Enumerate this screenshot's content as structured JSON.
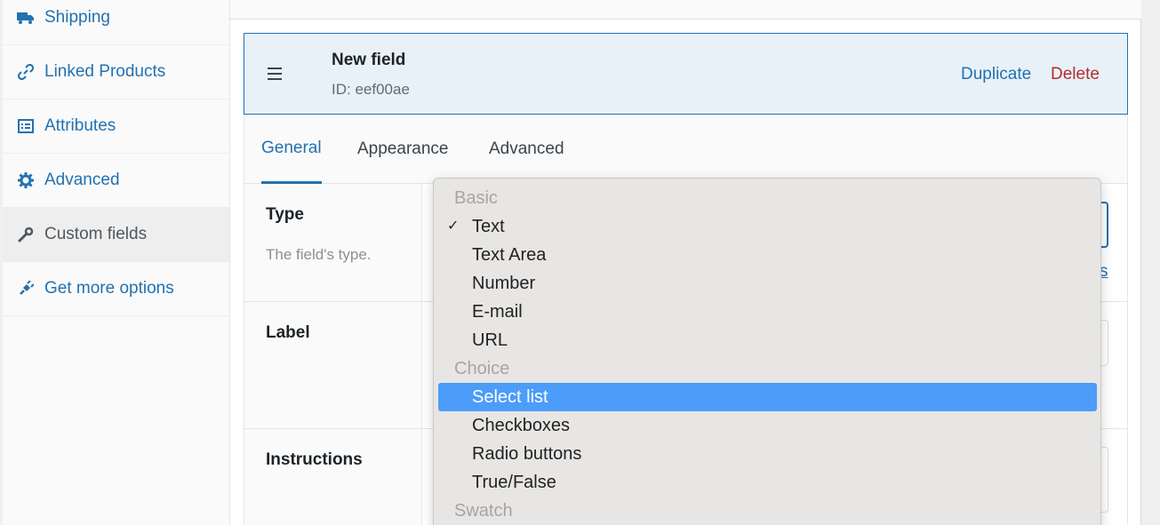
{
  "sidebar": {
    "items": [
      {
        "label": "Shipping",
        "icon": "truck-icon"
      },
      {
        "label": "Linked Products",
        "icon": "link-icon"
      },
      {
        "label": "Attributes",
        "icon": "list-icon"
      },
      {
        "label": "Advanced",
        "icon": "gear-icon"
      },
      {
        "label": "Custom fields",
        "icon": "wrench-icon",
        "active": true
      },
      {
        "label": "Get more options",
        "icon": "plugin-icon"
      }
    ]
  },
  "field": {
    "title": "New field",
    "id_text": "ID: eef00ae",
    "duplicate_label": "Duplicate",
    "delete_label": "Delete"
  },
  "tabs": [
    {
      "label": "General",
      "active": true
    },
    {
      "label": "Appearance"
    },
    {
      "label": "Advanced"
    }
  ],
  "rows": {
    "type": {
      "label": "Type",
      "description": "The field's type.",
      "link_tail": "s"
    },
    "label": {
      "label": "Label"
    },
    "instructions": {
      "label": "Instructions"
    }
  },
  "dropdown": {
    "groups": [
      {
        "label": "Basic",
        "options": [
          "Text",
          "Text Area",
          "Number",
          "E-mail",
          "URL"
        ]
      },
      {
        "label": "Choice",
        "options": [
          "Select list",
          "Checkboxes",
          "Radio buttons",
          "True/False"
        ]
      },
      {
        "label": "Swatch",
        "options": []
      }
    ],
    "checked": "Text",
    "highlighted": "Select list",
    "check_mark": "✓"
  },
  "colors": {
    "accent": "#2271b1",
    "delete": "#b32d2e",
    "highlight": "#4c9cf9"
  }
}
